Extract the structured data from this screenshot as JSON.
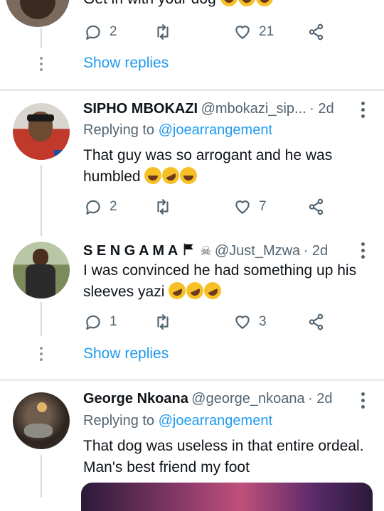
{
  "top_reply": {
    "text_partial": "Get in with your dog",
    "actions": {
      "reply_count": "2",
      "like_count": "21"
    },
    "show_replies": "Show replies"
  },
  "reply1": {
    "name": "SIPHO MBOKAZI",
    "handle": "@mbokazi_sip...",
    "time": "· 2d",
    "replying_prefix": "Replying to",
    "replying_to": "@joearrangement",
    "text_line1": "That guy was so arrogant and he was",
    "text_line2": "humbled",
    "actions": {
      "reply_count": "2",
      "like_count": "7"
    }
  },
  "reply2": {
    "name": "S E N G A M A",
    "handle": "@Just_Mzwa",
    "time": "· 2d",
    "text_line1": "I was convinced he had something up his",
    "text_line2": "sleeves yazi",
    "actions": {
      "reply_count": "1",
      "like_count": "3"
    },
    "show_replies": "Show replies"
  },
  "reply3": {
    "name": "George Nkoana",
    "handle": "@george_nkoana",
    "time": "· 2d",
    "replying_prefix": "Replying to",
    "replying_to": "@joearrangement",
    "text_line1": "That dog was useless in that entire ordeal.",
    "text_line2": "Man's best friend my foot"
  },
  "icons": [
    "reply-icon",
    "retweet-icon",
    "like-icon",
    "share-icon",
    "more-icon",
    "flag-icon",
    "skull-icon",
    "laughing-emoji",
    "rofl-emoji"
  ],
  "colors": {
    "link": "#1d9bf0",
    "muted": "#536471",
    "divider": "#e6ecf0"
  }
}
